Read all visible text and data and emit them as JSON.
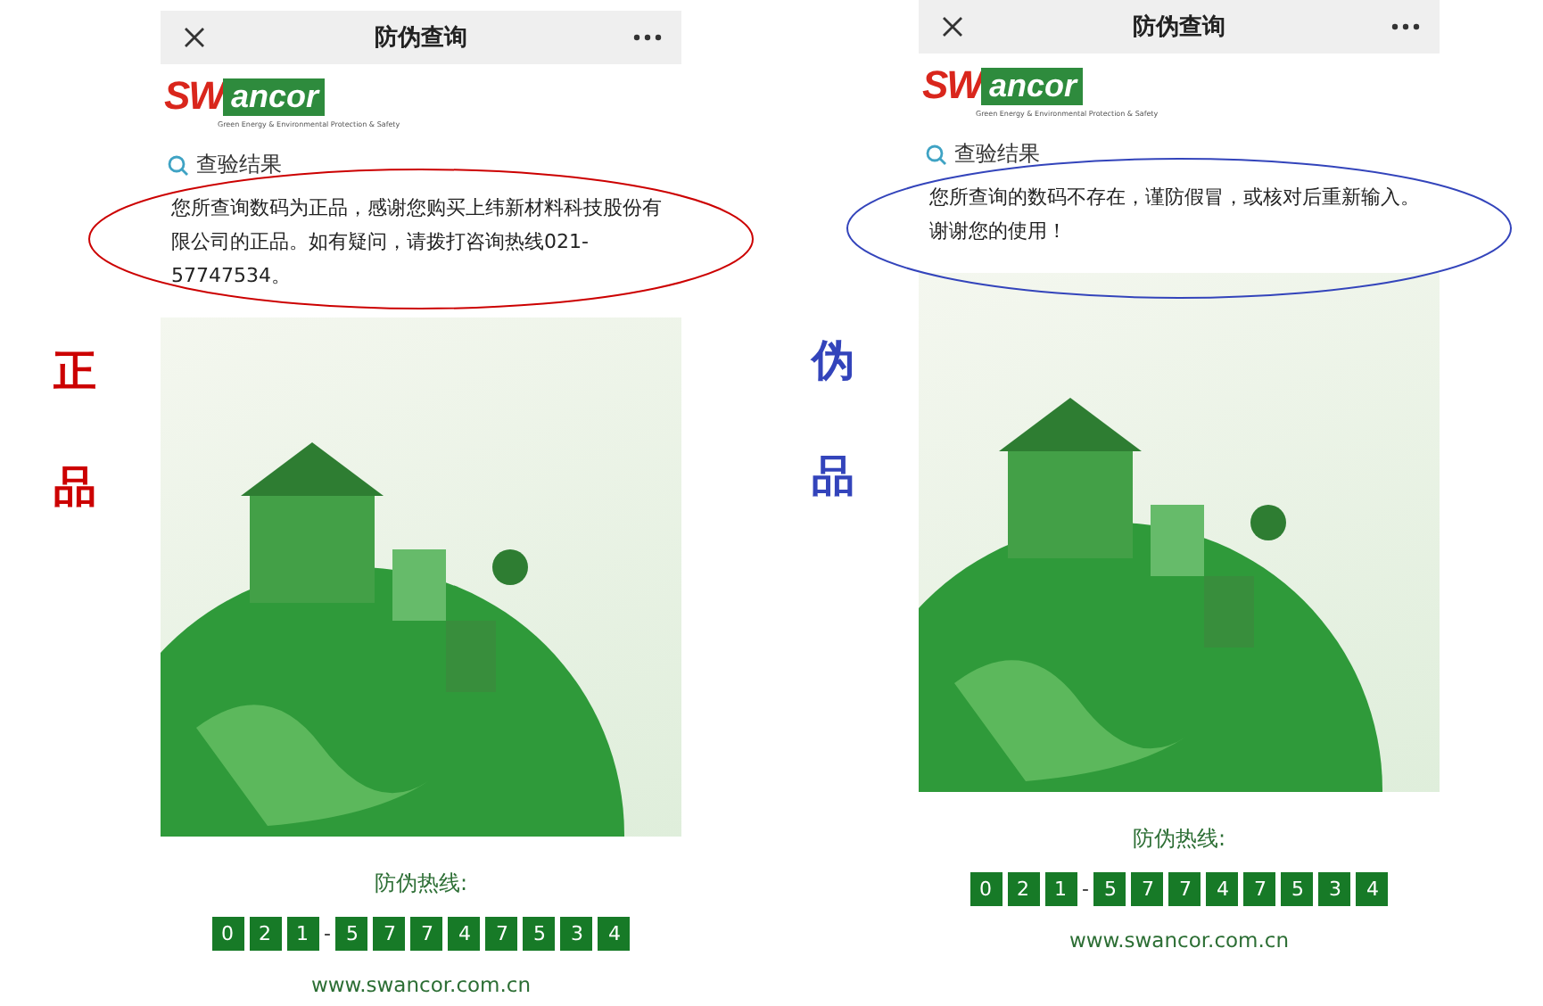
{
  "panels": [
    {
      "annotation": "正品",
      "color": "#cc0000",
      "title": "防伪查询",
      "logo_text": "SWancor",
      "logo_tagline": "Green Energy & Environmental Protection & Safety",
      "result_label": "查验结果",
      "message": "您所查询数码为正品，感谢您购买上纬新材料科技股份有限公司的正品。如有疑问，请拨打咨询热线021-57747534。",
      "hotline_label": "防伪热线:",
      "hotline": [
        {
          "kind": "digit",
          "text": "0"
        },
        {
          "kind": "digit",
          "text": "2"
        },
        {
          "kind": "digit",
          "text": "1"
        },
        {
          "kind": "separator",
          "text": "-"
        },
        {
          "kind": "digit",
          "text": "5"
        },
        {
          "kind": "digit",
          "text": "7"
        },
        {
          "kind": "digit",
          "text": "7"
        },
        {
          "kind": "digit",
          "text": "4"
        },
        {
          "kind": "digit",
          "text": "7"
        },
        {
          "kind": "digit",
          "text": "5"
        },
        {
          "kind": "digit",
          "text": "3"
        },
        {
          "kind": "digit",
          "text": "4"
        }
      ],
      "website": "www.swancor.com.cn"
    },
    {
      "annotation": "伪品",
      "color": "#3344bb",
      "title": "防伪查询",
      "logo_text": "SWancor",
      "logo_tagline": "Green Energy & Environmental Protection & Safety",
      "result_label": "查验结果",
      "message": "您所查询的数码不存在，谨防假冒，或核对后重新输入。谢谢您的使用！",
      "hotline_label": "防伪热线:",
      "hotline": [
        {
          "kind": "digit",
          "text": "0"
        },
        {
          "kind": "digit",
          "text": "2"
        },
        {
          "kind": "digit",
          "text": "1"
        },
        {
          "kind": "separator",
          "text": "-"
        },
        {
          "kind": "digit",
          "text": "5"
        },
        {
          "kind": "digit",
          "text": "7"
        },
        {
          "kind": "digit",
          "text": "7"
        },
        {
          "kind": "digit",
          "text": "4"
        },
        {
          "kind": "digit",
          "text": "7"
        },
        {
          "kind": "digit",
          "text": "5"
        },
        {
          "kind": "digit",
          "text": "3"
        },
        {
          "kind": "digit",
          "text": "4"
        }
      ],
      "website": "www.swancor.com.cn"
    }
  ]
}
